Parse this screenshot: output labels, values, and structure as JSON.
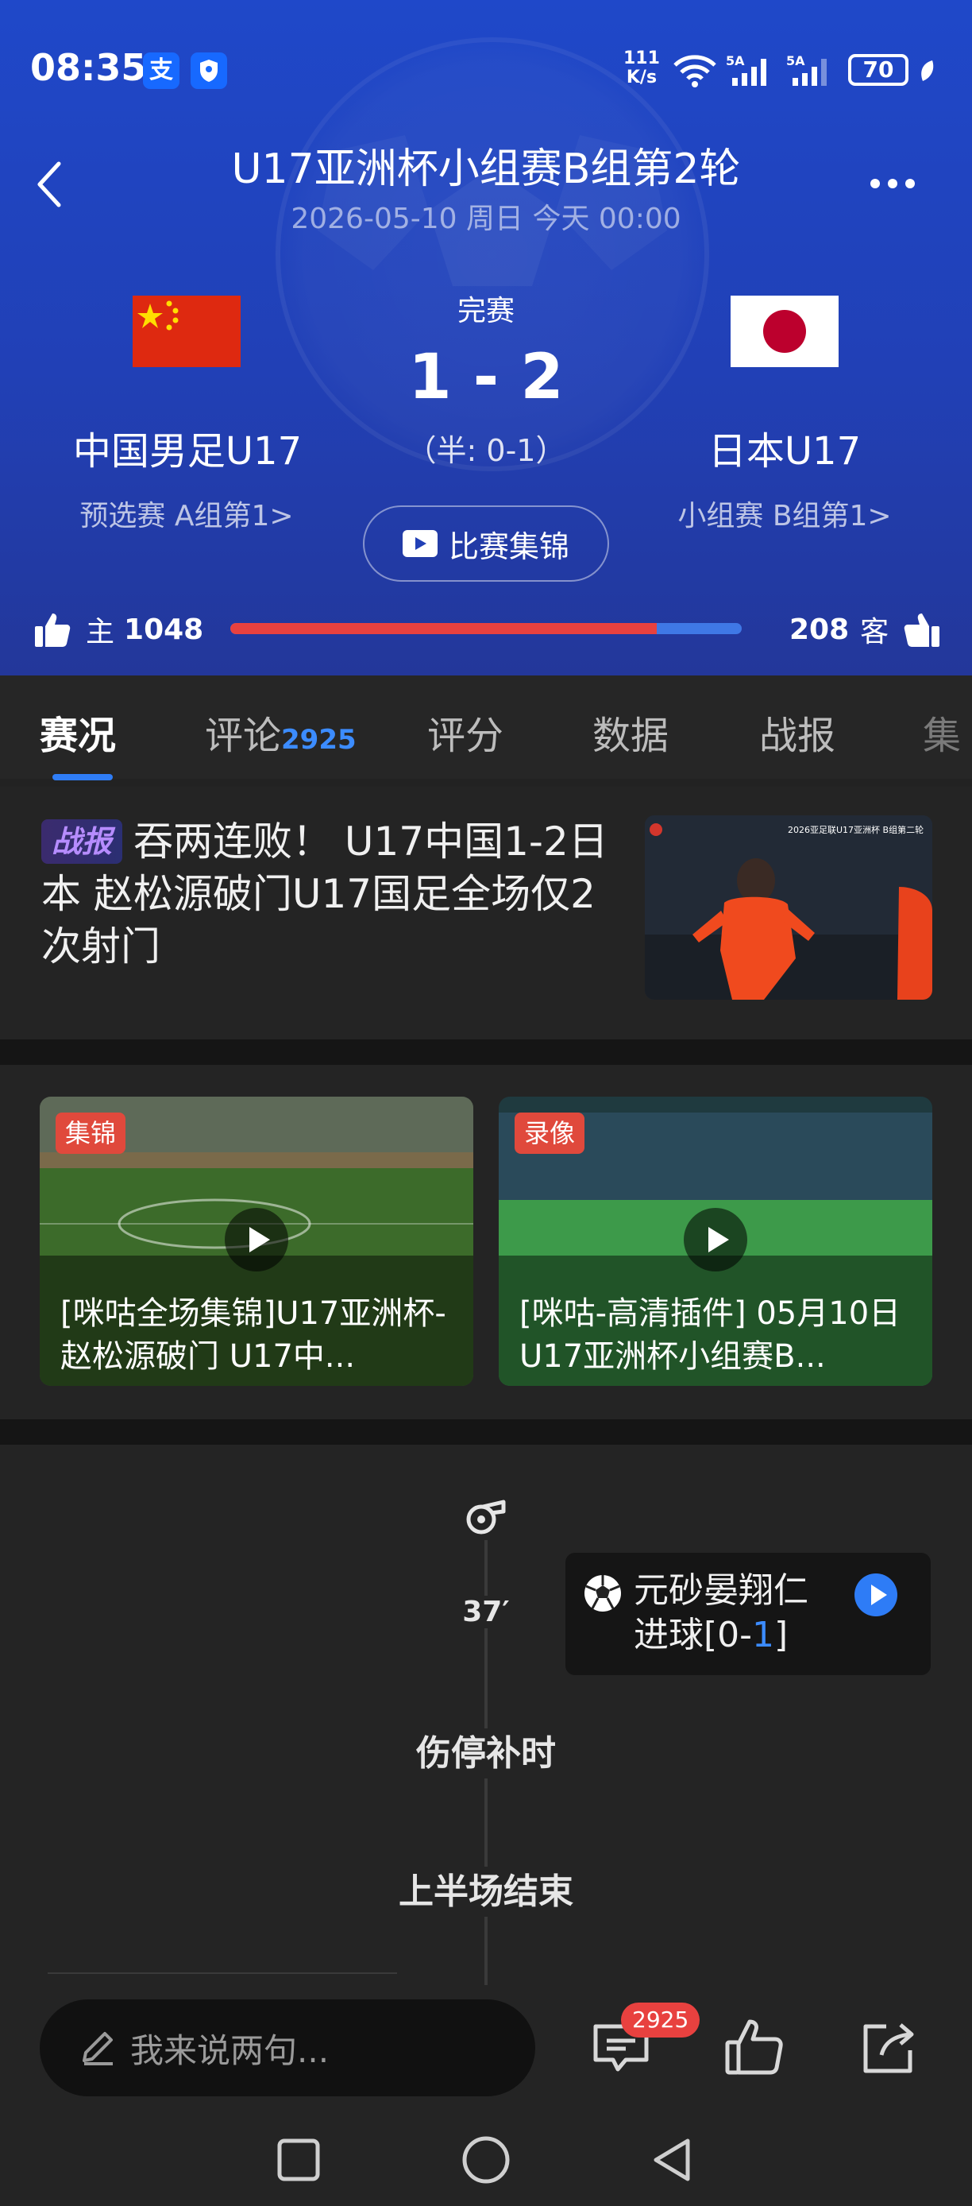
{
  "status_bar": {
    "time": "08:35",
    "app_icon_1": "支",
    "net_speed_value": "111",
    "net_speed_unit": "K/s",
    "wifi_label": "6",
    "sim1": "5A",
    "sim2": "5A",
    "battery": "70"
  },
  "header": {
    "title": "U17亚洲杯小组赛B组第2轮",
    "datetime": "2026-05-10 周日 今天 00:00",
    "status": "完赛",
    "score": "1 - 2",
    "half_score": "（半: 0-1）",
    "highlights_button": "比赛集锦",
    "home": {
      "name": "中国男足U17",
      "sub": "预选赛 A组第1>",
      "flag": "china"
    },
    "away": {
      "name": "日本U17",
      "sub": "小组赛 B组第1>",
      "flag": "japan"
    }
  },
  "votes": {
    "home_label": "主",
    "home_count": "1048",
    "away_label": "客",
    "away_count": "208",
    "home_share": 0.834
  },
  "tabs": [
    {
      "label": "赛况",
      "count": ""
    },
    {
      "label": "评论",
      "count": "2925"
    },
    {
      "label": "评分",
      "count": ""
    },
    {
      "label": "数据",
      "count": ""
    },
    {
      "label": "战报",
      "count": ""
    },
    {
      "label": "集",
      "count": ""
    }
  ],
  "news": {
    "tag": "战报",
    "text": "吞两连败！ U17中国1-2日本 赵松源破门U17国足全场仅2次射门",
    "thumb_caption": "2026亚足联U17亚洲杯 B组第二轮"
  },
  "videos": [
    {
      "badge": "集锦",
      "title": "[咪咕全场集锦]U17亚洲杯-赵松源破门 U17中..."
    },
    {
      "badge": "录像",
      "title": "[咪咕-高清插件] 05月10日 U17亚洲杯小组赛B..."
    }
  ],
  "timeline": {
    "minute": "37′",
    "event_player": "元砂晏翔仁",
    "event_action": "进球[0-",
    "event_score_away": "1",
    "event_close": "]",
    "stoppage": "伤停补时",
    "half_end": "上半场结束"
  },
  "bottom": {
    "comment_placeholder": "我来说两句...",
    "comment_count": "2925"
  },
  "colors": {
    "header_blue": "#2140b6",
    "accent_blue": "#2f7df6",
    "home_red": "#e8413f",
    "away_blue": "#3f78e6"
  }
}
